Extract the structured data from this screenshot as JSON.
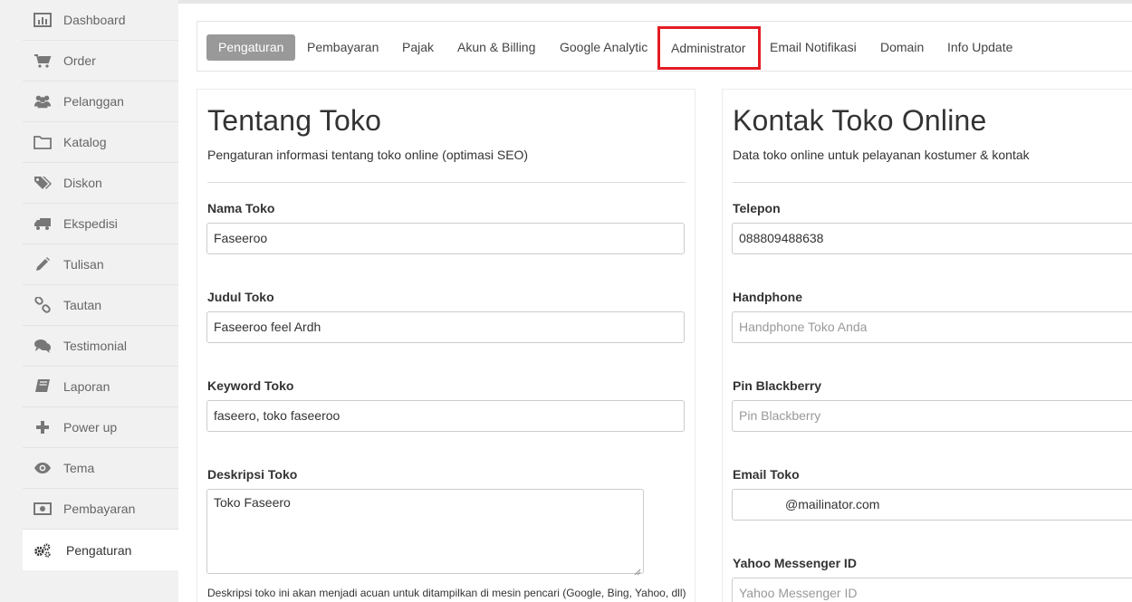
{
  "sidebar": {
    "items": [
      {
        "label": "Dashboard",
        "icon": "bar-chart-icon"
      },
      {
        "label": "Order",
        "icon": "cart-icon"
      },
      {
        "label": "Pelanggan",
        "icon": "users-icon"
      },
      {
        "label": "Katalog",
        "icon": "folder-icon"
      },
      {
        "label": "Diskon",
        "icon": "tags-icon"
      },
      {
        "label": "Ekspedisi",
        "icon": "truck-icon"
      },
      {
        "label": "Tulisan",
        "icon": "pencil-icon"
      },
      {
        "label": "Tautan",
        "icon": "link-icon"
      },
      {
        "label": "Testimonial",
        "icon": "comments-icon"
      },
      {
        "label": "Laporan",
        "icon": "book-icon"
      },
      {
        "label": "Power up",
        "icon": "plus-icon"
      },
      {
        "label": "Tema",
        "icon": "eye-icon"
      },
      {
        "label": "Pembayaran",
        "icon": "money-icon"
      },
      {
        "label": "Pengaturan",
        "icon": "cogs-icon",
        "active": true
      }
    ]
  },
  "tabs": [
    {
      "label": "Pengaturan",
      "active": true
    },
    {
      "label": "Pembayaran"
    },
    {
      "label": "Pajak"
    },
    {
      "label": "Akun & Billing"
    },
    {
      "label": "Google Analytic"
    },
    {
      "label": "Administrator",
      "highlighted": true
    },
    {
      "label": "Email Notifikasi"
    },
    {
      "label": "Domain"
    },
    {
      "label": "Info Update"
    }
  ],
  "about": {
    "title": "Tentang Toko",
    "subtitle": "Pengaturan informasi tentang toko online (optimasi SEO)",
    "name_label": "Nama Toko",
    "name_value": "Faseeroo",
    "heading_label": "Judul Toko",
    "heading_value": "Faseeroo feel Ardh",
    "keyword_label": "Keyword Toko",
    "keyword_value": "faseero, toko faseeroo",
    "description_label": "Deskripsi Toko",
    "description_value": "Toko Faseero",
    "description_help": "Deskripsi toko ini akan menjadi acuan untuk ditampilkan di mesin pencari (Google, Bing, Yahoo, dll)"
  },
  "contact": {
    "title": "Kontak Toko Online",
    "subtitle": "Data toko online untuk pelayanan kostumer & kontak",
    "phone_label": "Telepon",
    "phone_value": "088809488638",
    "handphone_label": "Handphone",
    "handphone_placeholder": "Handphone Toko Anda",
    "pin_label": "Pin Blackberry",
    "pin_placeholder": "Pin Blackberry",
    "email_label": "Email Toko",
    "email_value": "@mailinator.com",
    "yahoo_label": "Yahoo Messenger ID",
    "yahoo_placeholder": "Yahoo Messenger ID"
  },
  "colors": {
    "active_tab": "#999999",
    "highlight_border": "#e31b23",
    "icon_gray": "#777777"
  }
}
